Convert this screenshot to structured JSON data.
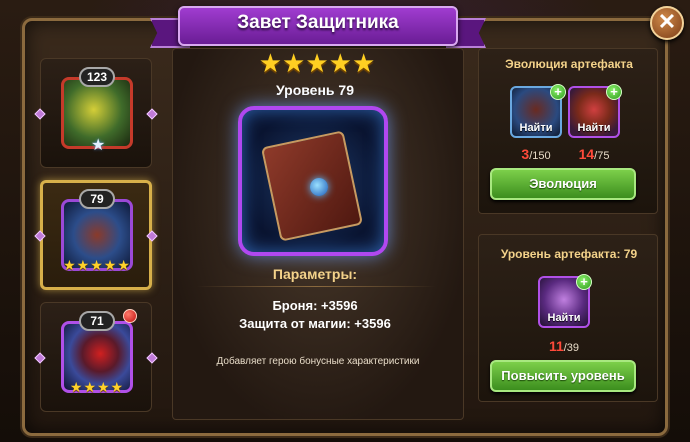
{
  "window": {
    "title": "Завет Защитника",
    "close_label": "✕"
  },
  "artifact_list": [
    {
      "level": "123",
      "stars": "★",
      "star_style": "silver"
    },
    {
      "level": "79",
      "stars": "★★★★★"
    },
    {
      "level": "71",
      "stars": "★★★★",
      "has_notification": true
    }
  ],
  "artifact": {
    "stars": "★★★★★",
    "level_label": "Уровень 79",
    "params_title": "Параметры:",
    "stats": [
      "Броня: +3596",
      "Защита от магии: +3596"
    ],
    "description": "Добавляет герою бонусные характеристики"
  },
  "evolution": {
    "title": "Эволюция артефакта",
    "materials": [
      {
        "find_label": "Найти",
        "have": "3",
        "need": "/150"
      },
      {
        "find_label": "Найти",
        "have": "14",
        "need": "/75"
      }
    ],
    "button_label": "Эволюция"
  },
  "level_up": {
    "title": "Уровень артефакта: 79",
    "material": {
      "find_label": "Найти",
      "have": "11",
      "need": "/39"
    },
    "button_label": "Повысить уровень"
  },
  "colors": {
    "accent_gold": "#f3d28a",
    "count_red": "#ff4a3a",
    "button_green": "#5aae34",
    "frame_purple": "#b048f0"
  }
}
